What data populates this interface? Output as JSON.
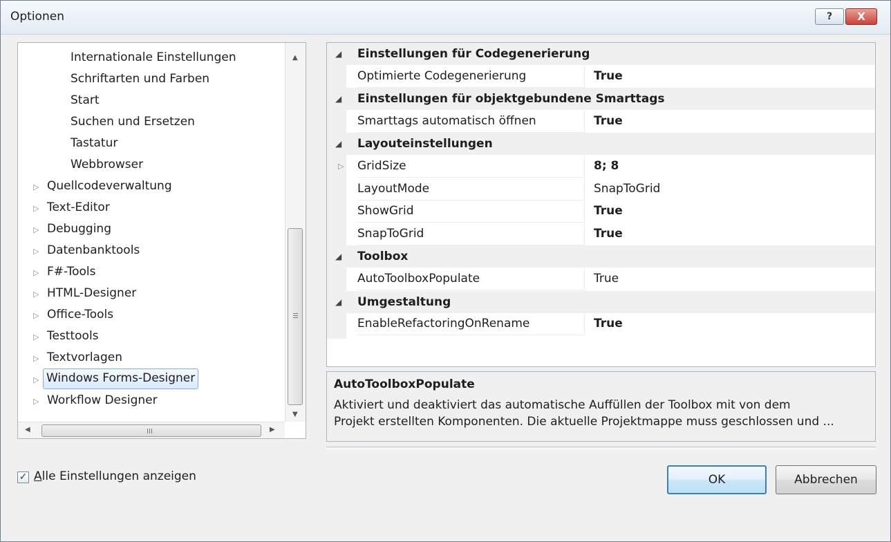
{
  "window": {
    "title": "Optionen",
    "help_glyph": "?",
    "close_glyph": "X"
  },
  "tree": {
    "items": [
      {
        "label": "Internationale Einstellungen",
        "level": 2
      },
      {
        "label": "Schriftarten und Farben",
        "level": 2
      },
      {
        "label": "Start",
        "level": 2
      },
      {
        "label": "Suchen und Ersetzen",
        "level": 2
      },
      {
        "label": "Tastatur",
        "level": 2
      },
      {
        "label": "Webbrowser",
        "level": 2
      },
      {
        "label": "Quellcodeverwaltung",
        "level": 1
      },
      {
        "label": "Text-Editor",
        "level": 1
      },
      {
        "label": "Debugging",
        "level": 1
      },
      {
        "label": "Datenbanktools",
        "level": 1
      },
      {
        "label": "F#-Tools",
        "level": 1
      },
      {
        "label": "HTML-Designer",
        "level": 1
      },
      {
        "label": "Office-Tools",
        "level": 1
      },
      {
        "label": "Testtools",
        "level": 1
      },
      {
        "label": "Textvorlagen",
        "level": 1
      },
      {
        "label": "Windows Forms-Designer",
        "level": 1,
        "selected": true
      },
      {
        "label": "Workflow Designer",
        "level": 1
      }
    ],
    "expand_glyph": "▷"
  },
  "propgrid": {
    "collapse_glyph": "◢",
    "expand_glyph": "▷",
    "categories": [
      {
        "label": "Einstellungen für Codegenerierung",
        "props": [
          {
            "name": "Optimierte Codegenerierung",
            "value": "True",
            "bold": true
          }
        ]
      },
      {
        "label": "Einstellungen für objektgebundene Smarttags",
        "props": [
          {
            "name": "Smarttags automatisch öffnen",
            "value": "True",
            "bold": true
          }
        ]
      },
      {
        "label": "Layouteinstellungen",
        "props": [
          {
            "name": "GridSize",
            "value": "8; 8",
            "bold": true,
            "expandable": true
          },
          {
            "name": "LayoutMode",
            "value": "SnapToGrid",
            "bold": false
          },
          {
            "name": "ShowGrid",
            "value": "True",
            "bold": true
          },
          {
            "name": "SnapToGrid",
            "value": "True",
            "bold": true
          }
        ]
      },
      {
        "label": "Toolbox",
        "props": [
          {
            "name": "AutoToolboxPopulate",
            "value": "True",
            "bold": false
          }
        ]
      },
      {
        "label": "Umgestaltung",
        "props": [
          {
            "name": "EnableRefactoringOnRename",
            "value": "True",
            "bold": true
          }
        ]
      }
    ]
  },
  "description": {
    "title": "AutoToolboxPopulate",
    "line1": "Aktiviert und deaktiviert das automatische Auffüllen der Toolbox mit von dem",
    "line2": "Projekt erstellten Komponenten. Die aktuelle Projektmappe muss geschlossen und ..."
  },
  "show_all": {
    "checked": true,
    "mnemonic": "A",
    "label_rest": "lle Einstellungen anzeigen",
    "check_glyph": "✓"
  },
  "buttons": {
    "ok": "OK",
    "cancel": "Abbrechen"
  }
}
